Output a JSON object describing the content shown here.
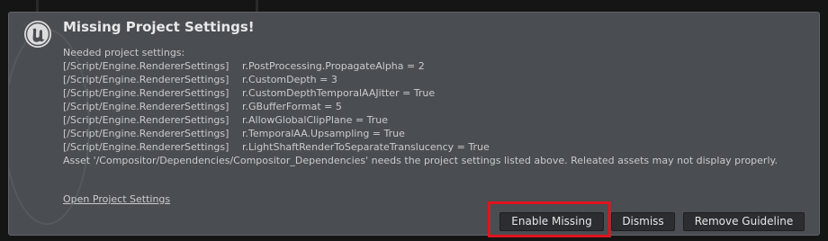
{
  "notification": {
    "title": "Missing Project Settings!",
    "intro": "Needed project settings:",
    "settings": [
      {
        "section": "[/Script/Engine.RendererSettings]",
        "value": "r.PostProcessing.PropagateAlpha = 2"
      },
      {
        "section": "[/Script/Engine.RendererSettings]",
        "value": "r.CustomDepth = 3"
      },
      {
        "section": "[/Script/Engine.RendererSettings]",
        "value": "r.CustomDepthTemporalAAJitter = True"
      },
      {
        "section": "[/Script/Engine.RendererSettings]",
        "value": "r.GBufferFormat = 5"
      },
      {
        "section": "[/Script/Engine.RendererSettings]",
        "value": "r.AllowGlobalClipPlane = True"
      },
      {
        "section": "[/Script/Engine.RendererSettings]",
        "value": "r.TemporalAA.Upsampling = True"
      },
      {
        "section": "[/Script/Engine.RendererSettings]",
        "value": "r.LightShaftRenderToSeparateTranslucency = True"
      }
    ],
    "asset_message": "Asset '/Compositor/Dependencies/Compositor_Dependencies' needs the project settings listed above. Releated assets may not display properly.",
    "link_label": "Open Project Settings",
    "buttons": {
      "enable_missing": "Enable Missing",
      "dismiss": "Dismiss",
      "remove_guideline": "Remove Guideline"
    },
    "logo_icon": "unreal-engine-logo-icon",
    "highlight_color": "#e0141e"
  }
}
